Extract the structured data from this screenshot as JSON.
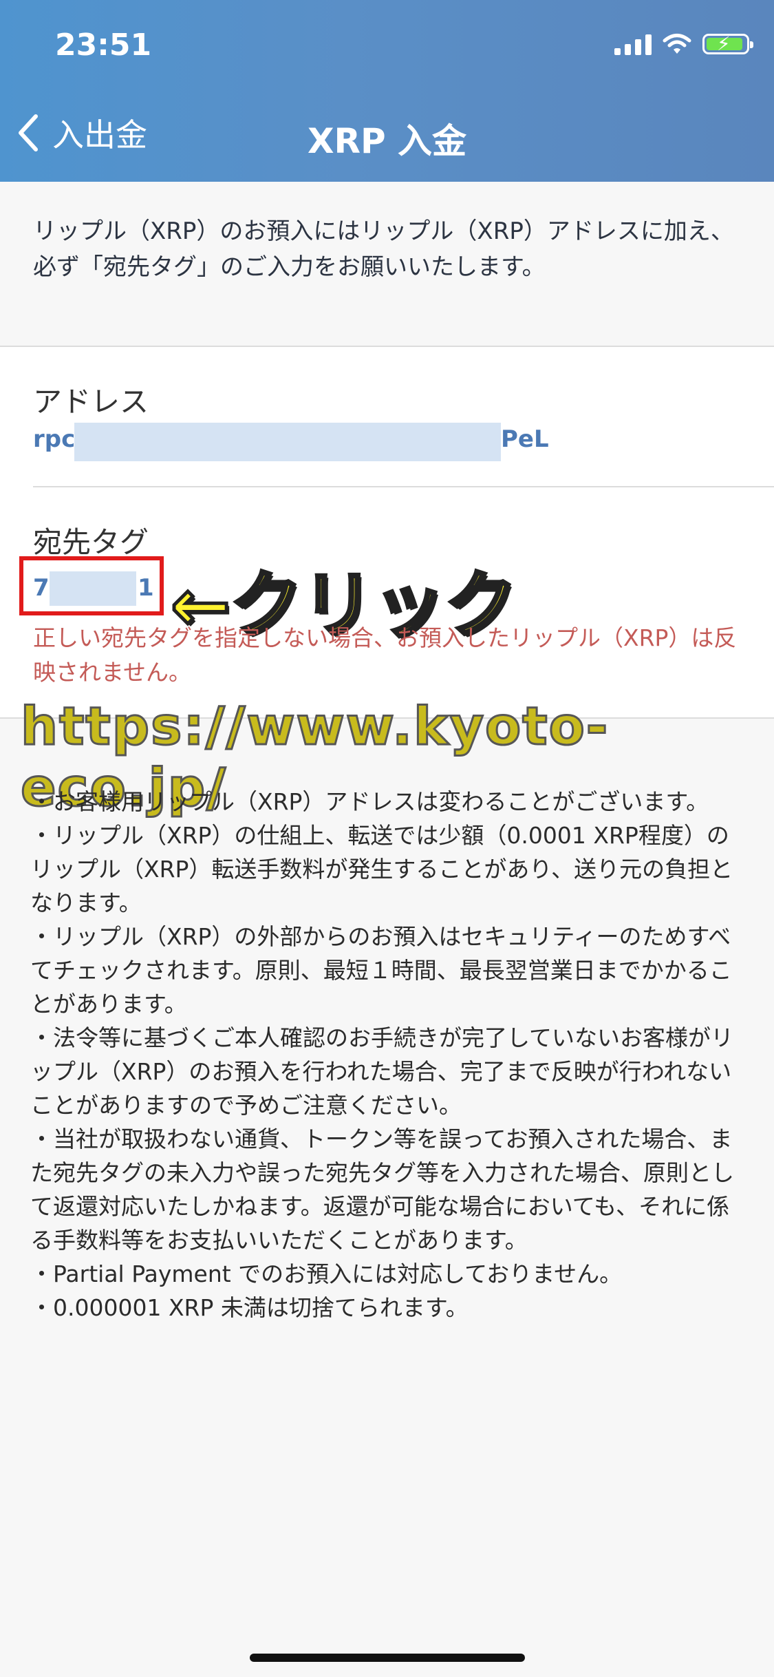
{
  "status_bar": {
    "time": "23:51"
  },
  "nav": {
    "back_label": "入出金",
    "title": "XRP 入金"
  },
  "intro": {
    "text": "リップル（XRP）のお預入にはリップル（XRP）アドレスに加え、必ず「宛先タグ」のご入力をお願いいたします。"
  },
  "address": {
    "label": "アドレス",
    "value_prefix": "rpc",
    "value_suffix": "PeL"
  },
  "destination_tag": {
    "label": "宛先タグ",
    "value_prefix": "7",
    "value_suffix": "1",
    "warning": "正しい宛先タグを指定しない場合、お預入したリップル（XRP）は反映されません。"
  },
  "annotation": {
    "arrow_text": "←クリック",
    "watermark": "https://www.kyoto-eco.jp/"
  },
  "notes": [
    "・お客様用リップル（XRP）アドレスは変わることがございます。",
    "・リップル（XRP）の仕組上、転送では少額（0.0001 XRP程度）のリップル（XRP）転送手数料が発生することがあり、送り元の負担となります。",
    "・リップル（XRP）の外部からのお預入はセキュリティーのためすべてチェックされます。原則、最短１時間、最長翌営業日までかかることがあります。",
    "・法令等に基づくご本人確認のお手続きが完了していないお客様がリップル（XRP）のお預入を行われた場合、完了まで反映が行われないことがありますので予めご注意ください。",
    "・当社が取扱わない通貨、トークン等を誤ってお預入された場合、また宛先タグの未入力や誤った宛先タグ等を入力された場合、原則として返還対応いたしかねます。返還が可能な場合においても、それに係る手数料等をお支払いいただくことがあります。",
    "・Partial Payment でのお預入には対応しておりません。",
    "・0.000001 XRP 未満は切捨てられます。"
  ],
  "colors": {
    "header": "#5a8fc7",
    "link": "#4b79b4",
    "warning": "#c45b57",
    "annotation_box": "#e11b1b",
    "annotation_text": "#fff230"
  }
}
